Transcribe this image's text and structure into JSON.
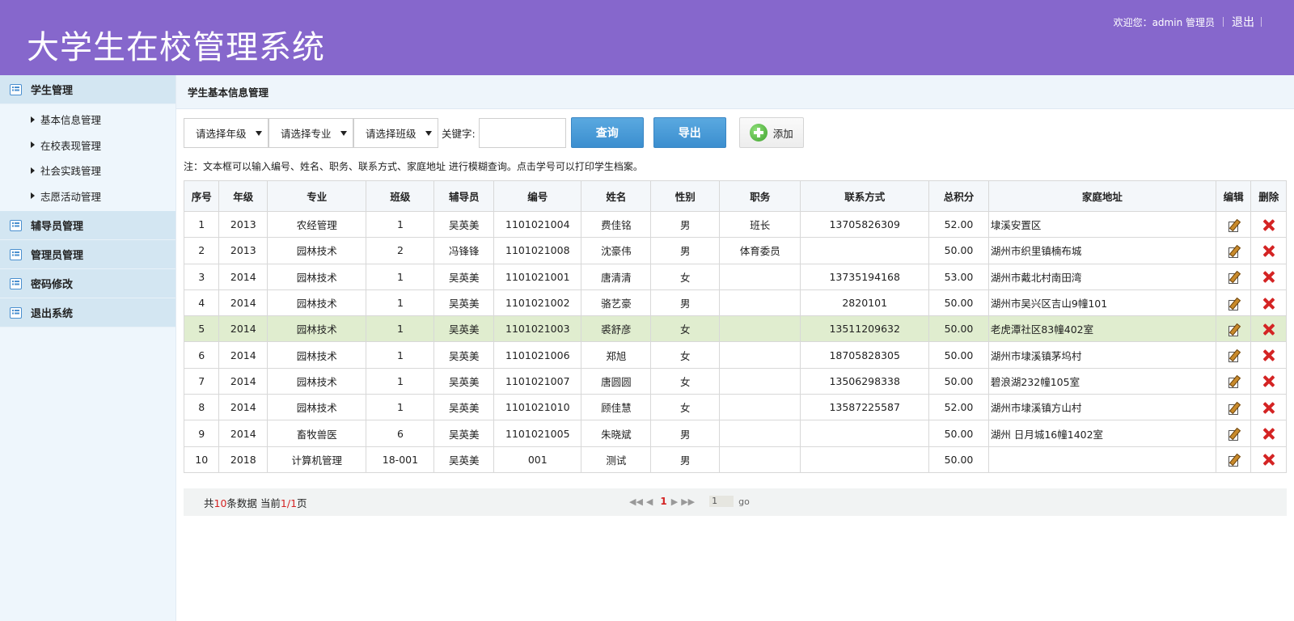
{
  "header": {
    "title": "大学生在校管理系统",
    "welcome": "欢迎您：admin 管理员",
    "logout": "退出"
  },
  "sidebar": {
    "groups": [
      {
        "label": "学生管理",
        "items": [
          "基本信息管理",
          "在校表现管理",
          "社会实践管理",
          "志愿活动管理"
        ]
      },
      {
        "label": "辅导员管理"
      },
      {
        "label": "管理员管理"
      },
      {
        "label": "密码修改"
      },
      {
        "label": "退出系统"
      }
    ]
  },
  "main": {
    "breadcrumb": "学生基本信息管理",
    "filters": {
      "grade": "请选择年级",
      "major": "请选择专业",
      "class": "请选择班级",
      "keyword_label": "关键字:",
      "keyword_value": ""
    },
    "buttons": {
      "query": "查询",
      "export": "导出",
      "add": "添加"
    },
    "note": "注：文本框可以输入编号、姓名、职务、联系方式、家庭地址 进行模糊查询。点击学号可以打印学生档案。",
    "table": {
      "headers": [
        "序号",
        "年级",
        "专业",
        "班级",
        "辅导员",
        "编号",
        "姓名",
        "性别",
        "职务",
        "联系方式",
        "总积分",
        "家庭地址",
        "编辑",
        "删除"
      ],
      "rows": [
        [
          "1",
          "2013",
          "农经管理",
          "1",
          "吴英美",
          "1101021004",
          "费佳铭",
          "男",
          "班长",
          "13705826309",
          "52.00",
          "埭溪安置区"
        ],
        [
          "2",
          "2013",
          "园林技术",
          "2",
          "冯锋锋",
          "1101021008",
          "沈豪伟",
          "男",
          "体育委员",
          "",
          "50.00",
          "湖州市织里镇楠布城"
        ],
        [
          "3",
          "2014",
          "园林技术",
          "1",
          "吴英美",
          "1101021001",
          "唐清清",
          "女",
          "",
          "13735194168",
          "53.00",
          "湖州市戴北村南田湾"
        ],
        [
          "4",
          "2014",
          "园林技术",
          "1",
          "吴英美",
          "1101021002",
          "骆艺豪",
          "男",
          "",
          "2820101",
          "50.00",
          "湖州市吴兴区吉山9幢101"
        ],
        [
          "5",
          "2014",
          "园林技术",
          "1",
          "吴英美",
          "1101021003",
          "裘舒彦",
          "女",
          "",
          "13511209632",
          "50.00",
          "老虎潭社区83幢402室"
        ],
        [
          "6",
          "2014",
          "园林技术",
          "1",
          "吴英美",
          "1101021006",
          "郑旭",
          "女",
          "",
          "18705828305",
          "50.00",
          "湖州市埭溪镇茅坞村"
        ],
        [
          "7",
          "2014",
          "园林技术",
          "1",
          "吴英美",
          "1101021007",
          "唐圆圆",
          "女",
          "",
          "13506298338",
          "50.00",
          "碧浪湖232幢105室"
        ],
        [
          "8",
          "2014",
          "园林技术",
          "1",
          "吴英美",
          "1101021010",
          "顾佳慧",
          "女",
          "",
          "13587225587",
          "52.00",
          "湖州市埭溪镇方山村"
        ],
        [
          "9",
          "2014",
          "畜牧兽医",
          "6",
          "吴英美",
          "1101021005",
          "朱晓斌",
          "男",
          "",
          "",
          "50.00",
          "湖州 日月城16幢1402室"
        ],
        [
          "10",
          "2018",
          "计算机管理",
          "18-001",
          "吴英美",
          "001",
          "测试",
          "男",
          "",
          "",
          "50.00",
          ""
        ]
      ],
      "highlight_row": 5
    },
    "pager": {
      "total_prefix": "共",
      "total": "10",
      "total_suffix": "条数据 当前",
      "current": "1",
      "slash": "/",
      "pages": "1",
      "pages_suffix": "页",
      "nav_first": "◀◀",
      "nav_prev": "◀",
      "nav_page": "1",
      "nav_next": "▶",
      "nav_last": "▶▶",
      "goto_value": "1",
      "go": "go"
    }
  },
  "colors": {
    "header": "#8667cc",
    "sidebar": "#eef6fc",
    "menu_head": "#d3e6f2",
    "button_blue": "#3b8ecf",
    "highlight_row": "#e0edcf",
    "delete_red": "#d42424"
  }
}
